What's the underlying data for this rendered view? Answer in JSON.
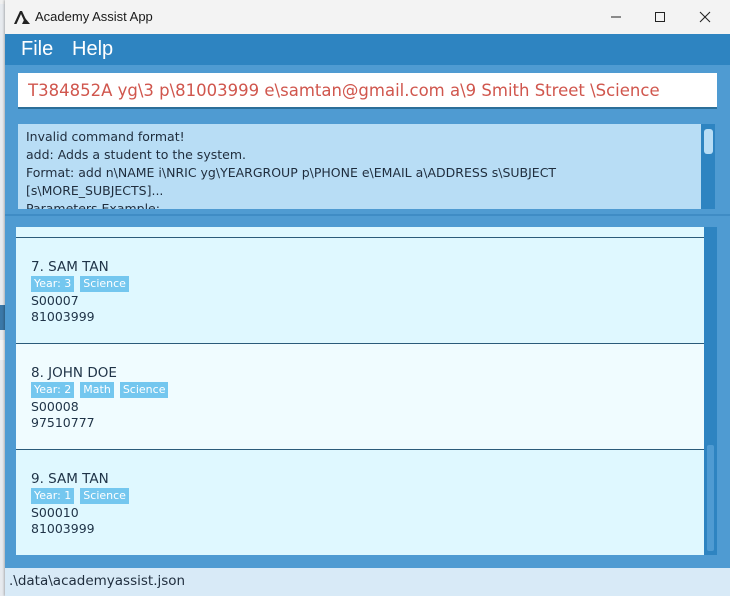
{
  "window": {
    "title": "Academy Assist App",
    "logo_icon": "academy-assist-logo"
  },
  "menu": {
    "items": [
      {
        "label": "File"
      },
      {
        "label": "Help"
      }
    ]
  },
  "command_box": {
    "value": "T384852A yg\\3 p\\81003999 e\\samtan@gmail.com a\\9 Smith Street \\Science"
  },
  "result_display": {
    "text": "Invalid command format!\nadd: Adds a student to the system.\nFormat: add n\\NAME i\\NRIC yg\\YEARGROUP p\\PHONE e\\EMAIL a\\ADDRESS s\\SUBJECT\n[s\\MORE_SUBJECTS]...\nParameters Example:"
  },
  "students": [
    {
      "name": "7. SAM TAN",
      "tags": [
        "Year: 3",
        "Science"
      ],
      "id": "S00007",
      "phone": "81003999"
    },
    {
      "name": "8. JOHN DOE",
      "tags": [
        "Year: 2",
        "Math",
        "Science"
      ],
      "id": "S00008",
      "phone": "97510777"
    },
    {
      "name": "9. SAM TAN",
      "tags": [
        "Year: 1",
        "Science"
      ],
      "id": "S00010",
      "phone": "81003999"
    }
  ],
  "status_bar": {
    "path": ".\\data\\academyassist.json"
  },
  "colors": {
    "menu_bar": "#2e84c1",
    "panel": "#4f9bd2",
    "command_text": "#d0564d",
    "result_bg": "#b8ddf5",
    "card_bg": "#dff8ff",
    "tag_bg": "#74c7ef"
  }
}
